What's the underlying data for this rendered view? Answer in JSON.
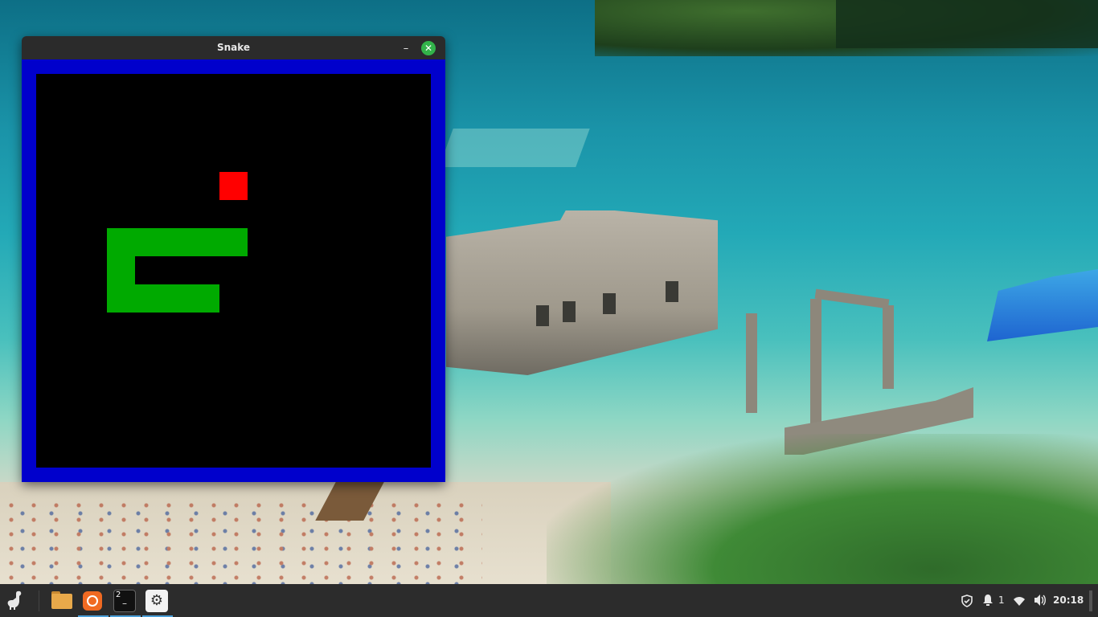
{
  "window": {
    "title": "Snake",
    "minimize_glyph": "–",
    "close_glyph": "✕",
    "border_color": "#0000cc",
    "board_color": "#000000"
  },
  "game": {
    "grid_cell_units": "cells",
    "food": {
      "col": 7,
      "row": 4,
      "color": "#ff0000"
    },
    "snake": {
      "color": "#00aa00",
      "segments": [
        [
          7,
          6
        ],
        [
          6,
          6
        ],
        [
          5,
          6
        ],
        [
          4,
          6
        ],
        [
          3,
          6
        ],
        [
          3,
          7
        ],
        [
          3,
          8
        ],
        [
          4,
          8
        ],
        [
          5,
          8
        ],
        [
          6,
          8
        ]
      ]
    }
  },
  "taskbar": {
    "menu_icon": "dinosaur-icon",
    "apps": [
      {
        "name": "files",
        "icon": "folder-icon"
      },
      {
        "name": "firefox",
        "icon": "firefox-icon"
      },
      {
        "name": "terminal",
        "icon": "terminal-icon",
        "badge": "2"
      },
      {
        "name": "settings",
        "icon": "gear-icon"
      }
    ],
    "tray": {
      "notification_count": "1",
      "clock": "20:18"
    }
  }
}
